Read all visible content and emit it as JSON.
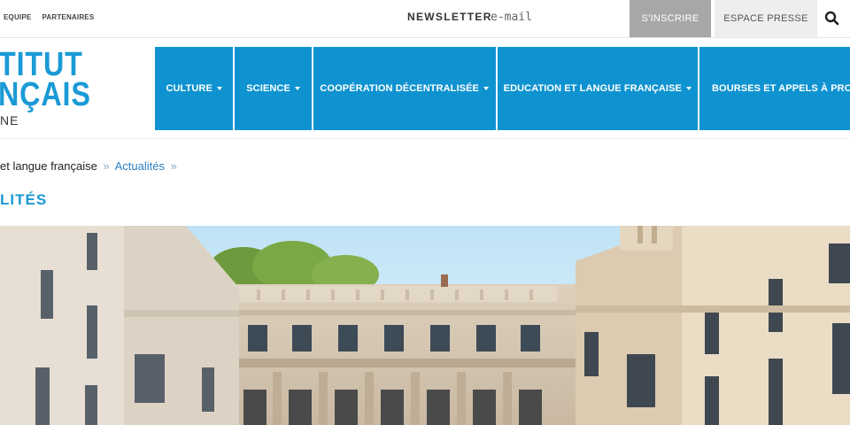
{
  "topbar": {
    "links": [
      "EQUIPE",
      "PARTENAIRES"
    ],
    "newsletter_label": "NEWSLETTER",
    "email_placeholder": "e-mail",
    "subscribe_label": "S'INSCRIRE",
    "press_label": "ESPACE PRESSE"
  },
  "logo": {
    "line1": "TITUT",
    "line2": "NÇAIS",
    "line3": "NE"
  },
  "nav": {
    "items": [
      {
        "label": "CULTURE"
      },
      {
        "label": "SCIENCE"
      },
      {
        "label": "COOPÉRATION DÉCENTRALISÉE"
      },
      {
        "label": "EDUCATION ET LANGUE FRANÇAISE"
      },
      {
        "label": "BOURSES ET APPELS À PRO"
      }
    ]
  },
  "breadcrumb": {
    "first": "et langue française",
    "separator": "»",
    "current": "Actualités"
  },
  "page": {
    "title": "LITÉS"
  },
  "colors": {
    "brand_blue": "#0f93d0",
    "subscribe_bg": "#a7a7a7",
    "link_blue": "#2c7fc0"
  }
}
